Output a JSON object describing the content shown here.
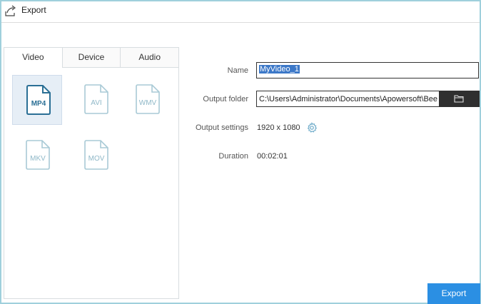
{
  "window": {
    "title": "Export"
  },
  "tabs": [
    {
      "label": "Video",
      "active": true
    },
    {
      "label": "Device",
      "active": false
    },
    {
      "label": "Audio",
      "active": false
    }
  ],
  "formats": [
    {
      "label": "MP4",
      "selected": true
    },
    {
      "label": "AVI",
      "selected": false
    },
    {
      "label": "WMV",
      "selected": false
    },
    {
      "label": "MKV",
      "selected": false
    },
    {
      "label": "MOV",
      "selected": false
    }
  ],
  "form": {
    "name_label": "Name",
    "name_value": "MyVideo_1",
    "folder_label": "Output folder",
    "folder_value": "C:\\Users\\Administrator\\Documents\\Apowersoft\\Bee",
    "settings_label": "Output settings",
    "settings_value": "1920 x 1080",
    "duration_label": "Duration",
    "duration_value": "00:02:01"
  },
  "actions": {
    "export_label": "Export"
  },
  "colors": {
    "accent": "#2b8fe3",
    "selected_format_bg": "#e6eef6",
    "text_selection": "#3c78c8",
    "folder_button": "#2f2f2f"
  },
  "icons": {
    "title": "export-share-icon",
    "folder": "folder-icon",
    "settings": "gear-icon"
  }
}
